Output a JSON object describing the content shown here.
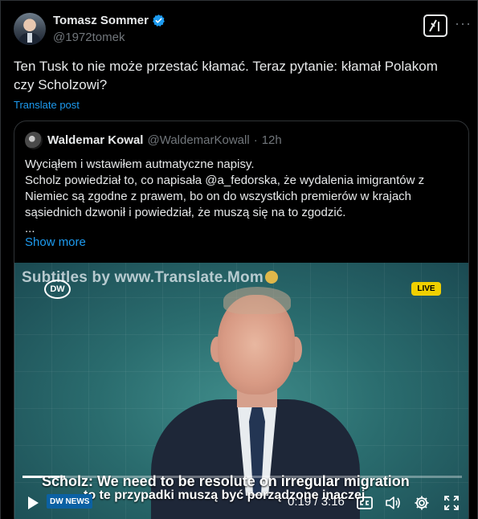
{
  "author": {
    "name": "Tomasz Sommer",
    "handle": "@1972tomek"
  },
  "post": {
    "text": "Ten Tusk to nie może przestać kłamać. Teraz pytanie: kłamał Polakom czy Scholzowi?",
    "translate_label": "Translate post"
  },
  "header_icons": {
    "grok": "grok-icon",
    "more": "more-icon",
    "more_glyph": "···"
  },
  "quote": {
    "name": "Waldemar Kowal",
    "handle": "@WaldemarKowall",
    "separator": "·",
    "time": "12h",
    "lines": [
      "Wyciąłem i wstawiłem autmatyczne napisy.",
      "Scholz powiedział to, co napisała @a_fedorska, że wydalenia imigrantów z",
      "Niemiec są zgodne z prawem, bo on do wszystkich premierów w krajach",
      "sąsiednich dzwonił i powiedział, że muszą się na to zgodzić.",
      "..."
    ],
    "show_more": "Show more"
  },
  "video": {
    "watermark": "Subtitles by www.Translate.Mom",
    "channel_logo": "DW",
    "live_badge": "LIVE",
    "caption_en": "Scholz: We need to be resolute on irregular migration",
    "caption_pl": "to te przypadki muszą być porządzone inaczej",
    "news_logo": "DW NEWS",
    "time_display": "0:19 / 3:16",
    "progress": 0.097
  },
  "colors": {
    "background": "#000000",
    "text": "#e7e9ea",
    "muted": "#71767b",
    "accent": "#1d9bf0",
    "border": "#2f3336",
    "live": "#f0d000"
  }
}
